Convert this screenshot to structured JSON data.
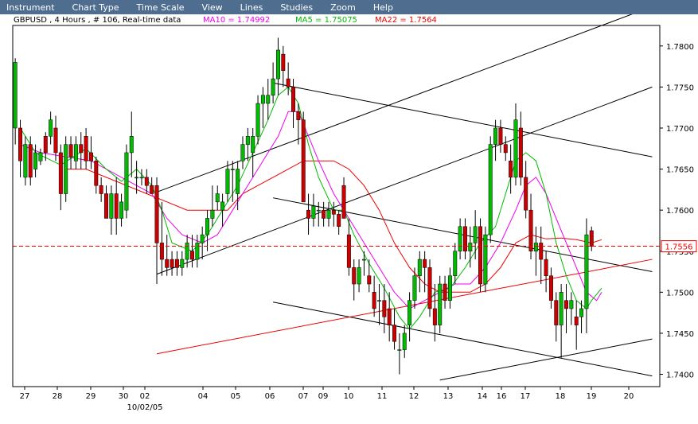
{
  "menu": [
    "Instrument",
    "Chart Type",
    "Time Scale",
    "View",
    "Lines",
    "Studies",
    "Zoom",
    "Help"
  ],
  "chart_data": {
    "type": "candlestick",
    "header": {
      "symbol": "GBPUSD , 4 Hours , # 106, Real-time data",
      "ma10": "MA10 = 1.74992",
      "ma5": "MA5 = 1.75075",
      "ma22": "MA22 = 1.7564"
    },
    "colors": {
      "up": "#00bb00",
      "down": "#cc0000",
      "ma10": "#ee00ee",
      "ma5": "#00bb00",
      "ma22": "#ee0000",
      "background": "#ffffff",
      "axis": "#000000"
    },
    "ylim": [
      1.7385,
      1.7825
    ],
    "yticks": [
      "1.7400",
      "1.7450",
      "1.7500",
      "1.7550",
      "1.7600",
      "1.7650",
      "1.7700",
      "1.7750",
      "1.7800"
    ],
    "current_price": "1.7556",
    "x_labels": [
      "27",
      "28",
      "29",
      "30",
      "02",
      "04",
      "05",
      "06",
      "07",
      "09",
      "10",
      "11",
      "12",
      "13",
      "14",
      "16",
      "17",
      "18",
      "19",
      "20"
    ],
    "date_label": "10/02/05",
    "candles": [
      [
        1.77,
        1.7785,
        1.768,
        1.778
      ],
      [
        1.77,
        1.771,
        1.764,
        1.766
      ],
      [
        1.764,
        1.769,
        1.763,
        1.768
      ],
      [
        1.768,
        1.769,
        1.763,
        1.764
      ],
      [
        1.765,
        1.768,
        1.764,
        1.767
      ],
      [
        1.766,
        1.7675,
        1.7655,
        1.767
      ],
      [
        1.769,
        1.7695,
        1.766,
        1.767
      ],
      [
        1.769,
        1.772,
        1.768,
        1.771
      ],
      [
        1.77,
        1.7715,
        1.766,
        1.767
      ],
      [
        1.767,
        1.768,
        1.76,
        1.762
      ],
      [
        1.762,
        1.769,
        1.761,
        1.768
      ],
      [
        1.768,
        1.769,
        1.765,
        1.7665
      ],
      [
        1.766,
        1.769,
        1.765,
        1.768
      ],
      [
        1.768,
        1.7695,
        1.765,
        1.767
      ],
      [
        1.769,
        1.77,
        1.765,
        1.766
      ],
      [
        1.767,
        1.769,
        1.765,
        1.766
      ],
      [
        1.766,
        1.7665,
        1.762,
        1.763
      ],
      [
        1.763,
        1.764,
        1.761,
        1.762
      ],
      [
        1.762,
        1.763,
        1.759,
        1.759
      ],
      [
        1.759,
        1.763,
        1.757,
        1.762
      ],
      [
        1.762,
        1.764,
        1.757,
        1.759
      ],
      [
        1.759,
        1.762,
        1.758,
        1.761
      ],
      [
        1.76,
        1.768,
        1.759,
        1.767
      ],
      [
        1.767,
        1.772,
        1.764,
        1.769
      ],
      [
        1.764,
        1.766,
        1.762,
        1.764
      ],
      [
        1.764,
        1.765,
        1.763,
        1.764
      ],
      [
        1.764,
        1.765,
        1.762,
        1.763
      ],
      [
        1.763,
        1.764,
        1.762,
        1.762
      ],
      [
        1.763,
        1.764,
        1.751,
        1.756
      ],
      [
        1.756,
        1.761,
        1.752,
        1.754
      ],
      [
        1.754,
        1.757,
        1.752,
        1.753
      ],
      [
        1.754,
        1.755,
        1.752,
        1.753
      ],
      [
        1.754,
        1.755,
        1.752,
        1.753
      ],
      [
        1.753,
        1.755,
        1.752,
        1.754
      ],
      [
        1.754,
        1.757,
        1.753,
        1.756
      ],
      [
        1.755,
        1.757,
        1.753,
        1.754
      ],
      [
        1.754,
        1.757,
        1.753,
        1.756
      ],
      [
        1.756,
        1.758,
        1.754,
        1.757
      ],
      [
        1.757,
        1.76,
        1.755,
        1.759
      ],
      [
        1.759,
        1.763,
        1.758,
        1.76
      ],
      [
        1.761,
        1.763,
        1.76,
        1.762
      ],
      [
        1.76,
        1.762,
        1.758,
        1.761
      ],
      [
        1.762,
        1.766,
        1.761,
        1.765
      ],
      [
        1.765,
        1.766,
        1.761,
        1.765
      ],
      [
        1.762,
        1.766,
        1.76,
        1.765
      ],
      [
        1.766,
        1.769,
        1.765,
        1.768
      ],
      [
        1.768,
        1.77,
        1.766,
        1.769
      ],
      [
        1.767,
        1.77,
        1.764,
        1.769
      ],
      [
        1.769,
        1.774,
        1.768,
        1.773
      ],
      [
        1.773,
        1.775,
        1.77,
        1.774
      ],
      [
        1.773,
        1.776,
        1.771,
        1.774
      ],
      [
        1.774,
        1.778,
        1.773,
        1.776
      ],
      [
        1.776,
        1.781,
        1.774,
        1.7795
      ],
      [
        1.779,
        1.78,
        1.775,
        1.777
      ],
      [
        1.776,
        1.778,
        1.774,
        1.775
      ],
      [
        1.775,
        1.776,
        1.77,
        1.772
      ],
      [
        1.772,
        1.773,
        1.768,
        1.771
      ],
      [
        1.771,
        1.772,
        1.762,
        1.761
      ],
      [
        1.76,
        1.762,
        1.757,
        1.759
      ],
      [
        1.759,
        1.762,
        1.758,
        1.7605
      ],
      [
        1.76,
        1.761,
        1.758,
        1.76
      ],
      [
        1.76,
        1.761,
        1.758,
        1.759
      ],
      [
        1.759,
        1.761,
        1.758,
        1.76
      ],
      [
        1.76,
        1.761,
        1.758,
        1.7595
      ],
      [
        1.7595,
        1.76,
        1.757,
        1.758
      ],
      [
        1.763,
        1.764,
        1.759,
        1.759
      ],
      [
        1.757,
        1.759,
        1.752,
        1.753
      ],
      [
        1.753,
        1.754,
        1.749,
        1.751
      ],
      [
        1.751,
        1.754,
        1.75,
        1.753
      ],
      [
        1.754,
        1.755,
        1.752,
        1.754
      ],
      [
        1.752,
        1.754,
        1.75,
        1.751
      ],
      [
        1.75,
        1.752,
        1.747,
        1.748
      ],
      [
        1.749,
        1.751,
        1.746,
        1.749
      ],
      [
        1.749,
        1.751,
        1.745,
        1.747
      ],
      [
        1.748,
        1.75,
        1.744,
        1.746
      ],
      [
        1.746,
        1.748,
        1.743,
        1.744
      ],
      [
        1.743,
        1.745,
        1.74,
        1.743
      ],
      [
        1.743,
        1.746,
        1.742,
        1.745
      ],
      [
        1.746,
        1.75,
        1.744,
        1.749
      ],
      [
        1.749,
        1.753,
        1.748,
        1.752
      ],
      [
        1.752,
        1.755,
        1.75,
        1.754
      ],
      [
        1.754,
        1.755,
        1.75,
        1.753
      ],
      [
        1.753,
        1.754,
        1.747,
        1.748
      ],
      [
        1.748,
        1.751,
        1.744,
        1.746
      ],
      [
        1.746,
        1.752,
        1.745,
        1.751
      ],
      [
        1.751,
        1.752,
        1.748,
        1.749
      ],
      [
        1.749,
        1.753,
        1.748,
        1.752
      ],
      [
        1.752,
        1.756,
        1.751,
        1.755
      ],
      [
        1.755,
        1.759,
        1.754,
        1.758
      ],
      [
        1.758,
        1.759,
        1.754,
        1.755
      ],
      [
        1.755,
        1.758,
        1.753,
        1.756
      ],
      [
        1.756,
        1.76,
        1.754,
        1.758
      ],
      [
        1.758,
        1.759,
        1.75,
        1.751
      ],
      [
        1.751,
        1.758,
        1.75,
        1.757
      ],
      [
        1.757,
        1.769,
        1.756,
        1.768
      ],
      [
        1.768,
        1.771,
        1.766,
        1.77
      ],
      [
        1.77,
        1.771,
        1.767,
        1.768
      ],
      [
        1.768,
        1.769,
        1.766,
        1.767
      ],
      [
        1.766,
        1.768,
        1.762,
        1.764
      ],
      [
        1.764,
        1.773,
        1.763,
        1.771
      ],
      [
        1.77,
        1.772,
        1.763,
        1.764
      ],
      [
        1.764,
        1.766,
        1.759,
        1.76
      ],
      [
        1.76,
        1.762,
        1.754,
        1.755
      ],
      [
        1.755,
        1.758,
        1.752,
        1.756
      ],
      [
        1.756,
        1.758,
        1.751,
        1.754
      ],
      [
        1.754,
        1.755,
        1.75,
        1.752
      ],
      [
        1.752,
        1.753,
        1.748,
        1.749
      ],
      [
        1.749,
        1.75,
        1.744,
        1.746
      ],
      [
        1.746,
        1.751,
        1.742,
        1.75
      ],
      [
        1.749,
        1.751,
        1.745,
        1.748
      ],
      [
        1.748,
        1.75,
        1.746,
        1.749
      ],
      [
        1.747,
        1.749,
        1.743,
        1.746
      ],
      [
        1.747,
        1.749,
        1.745,
        1.748
      ],
      [
        1.748,
        1.759,
        1.745,
        1.757
      ],
      [
        1.7575,
        1.758,
        1.755,
        1.7556
      ]
    ],
    "ma5": [
      [
        1,
        1.77
      ],
      [
        4,
        1.767
      ],
      [
        9,
        1.7655
      ],
      [
        14,
        1.7675
      ],
      [
        18,
        1.765
      ],
      [
        21,
        1.7635
      ],
      [
        24,
        1.765
      ],
      [
        27,
        1.763
      ],
      [
        29,
        1.76
      ],
      [
        31,
        1.756
      ],
      [
        35,
        1.755
      ],
      [
        38,
        1.757
      ],
      [
        41,
        1.76
      ],
      [
        44,
        1.763
      ],
      [
        47,
        1.767
      ],
      [
        50,
        1.771
      ],
      [
        52,
        1.774
      ],
      [
        54,
        1.775
      ],
      [
        56,
        1.773
      ],
      [
        58,
        1.768
      ],
      [
        60,
        1.764
      ],
      [
        63,
        1.76
      ],
      [
        65,
        1.76
      ],
      [
        67,
        1.757
      ],
      [
        70,
        1.7535
      ],
      [
        73,
        1.7505
      ],
      [
        76,
        1.747
      ],
      [
        78,
        1.7455
      ],
      [
        80,
        1.747
      ],
      [
        83,
        1.75
      ],
      [
        86,
        1.7505
      ],
      [
        89,
        1.753
      ],
      [
        92,
        1.756
      ],
      [
        95,
        1.758
      ],
      [
        97,
        1.762
      ],
      [
        99,
        1.766
      ],
      [
        101,
        1.767
      ],
      [
        103,
        1.766
      ],
      [
        105,
        1.762
      ],
      [
        107,
        1.756
      ],
      [
        109,
        1.752
      ],
      [
        111,
        1.749
      ],
      [
        113,
        1.748
      ],
      [
        114,
        1.749
      ],
      [
        116,
        1.7505
      ]
    ],
    "ma10": [
      [
        1,
        1.768
      ],
      [
        5,
        1.767
      ],
      [
        10,
        1.7665
      ],
      [
        15,
        1.766
      ],
      [
        18,
        1.765
      ],
      [
        21,
        1.764
      ],
      [
        24,
        1.763
      ],
      [
        27,
        1.762
      ],
      [
        30,
        1.759
      ],
      [
        33,
        1.757
      ],
      [
        37,
        1.756
      ],
      [
        40,
        1.757
      ],
      [
        43,
        1.76
      ],
      [
        46,
        1.763
      ],
      [
        49,
        1.766
      ],
      [
        52,
        1.769
      ],
      [
        54,
        1.772
      ],
      [
        56,
        1.772
      ],
      [
        58,
        1.769
      ],
      [
        60,
        1.766
      ],
      [
        63,
        1.762
      ],
      [
        66,
        1.759
      ],
      [
        69,
        1.756
      ],
      [
        72,
        1.753
      ],
      [
        75,
        1.75
      ],
      [
        78,
        1.748
      ],
      [
        81,
        1.749
      ],
      [
        84,
        1.75
      ],
      [
        87,
        1.751
      ],
      [
        90,
        1.751
      ],
      [
        93,
        1.753
      ],
      [
        96,
        1.756
      ],
      [
        99,
        1.76
      ],
      [
        101,
        1.763
      ],
      [
        103,
        1.764
      ],
      [
        105,
        1.762
      ],
      [
        107,
        1.759
      ],
      [
        109,
        1.756
      ],
      [
        111,
        1.753
      ],
      [
        113,
        1.75
      ],
      [
        115,
        1.749
      ],
      [
        116,
        1.75
      ]
    ],
    "ma22": [
      [
        10,
        1.765
      ],
      [
        14,
        1.765
      ],
      [
        18,
        1.764
      ],
      [
        22,
        1.763
      ],
      [
        26,
        1.762
      ],
      [
        30,
        1.761
      ],
      [
        34,
        1.76
      ],
      [
        38,
        1.76
      ],
      [
        42,
        1.76
      ],
      [
        45,
        1.762
      ],
      [
        48,
        1.763
      ],
      [
        51,
        1.764
      ],
      [
        54,
        1.765
      ],
      [
        57,
        1.766
      ],
      [
        60,
        1.766
      ],
      [
        63,
        1.766
      ],
      [
        66,
        1.765
      ],
      [
        69,
        1.763
      ],
      [
        72,
        1.76
      ],
      [
        75,
        1.756
      ],
      [
        78,
        1.753
      ],
      [
        81,
        1.751
      ],
      [
        84,
        1.75
      ],
      [
        87,
        1.75
      ],
      [
        90,
        1.75
      ],
      [
        93,
        1.751
      ],
      [
        96,
        1.753
      ],
      [
        99,
        1.756
      ],
      [
        102,
        1.757
      ],
      [
        105,
        1.7565
      ],
      [
        108,
        1.7566
      ],
      [
        111,
        1.7564
      ],
      [
        114,
        1.756
      ],
      [
        116,
        1.7564
      ]
    ],
    "trendlines": [
      {
        "kind": "channel",
        "color": "#000000",
        "from": [
          28,
          1.7522
        ],
        "to": [
          126,
          1.775
        ]
      },
      {
        "kind": "channel",
        "color": "#000000",
        "from": [
          28,
          1.7622
        ],
        "to": [
          126,
          1.7848
        ]
      },
      {
        "kind": "channel",
        "color": "#000000",
        "from": [
          51,
          1.7755
        ],
        "to": [
          126,
          1.7665
        ]
      },
      {
        "kind": "channel",
        "color": "#000000",
        "from": [
          51,
          1.7615
        ],
        "to": [
          126,
          1.7525
        ]
      },
      {
        "kind": "channel",
        "color": "#000000",
        "from": [
          51,
          1.7488
        ],
        "to": [
          126,
          1.7398
        ]
      },
      {
        "kind": "channel",
        "color": "#000000",
        "from": [
          84,
          1.7393
        ],
        "to": [
          126,
          1.7443
        ]
      },
      {
        "kind": "trend",
        "color": "#ee0000",
        "from": [
          28,
          1.7425
        ],
        "to": [
          126,
          1.754
        ]
      }
    ]
  }
}
